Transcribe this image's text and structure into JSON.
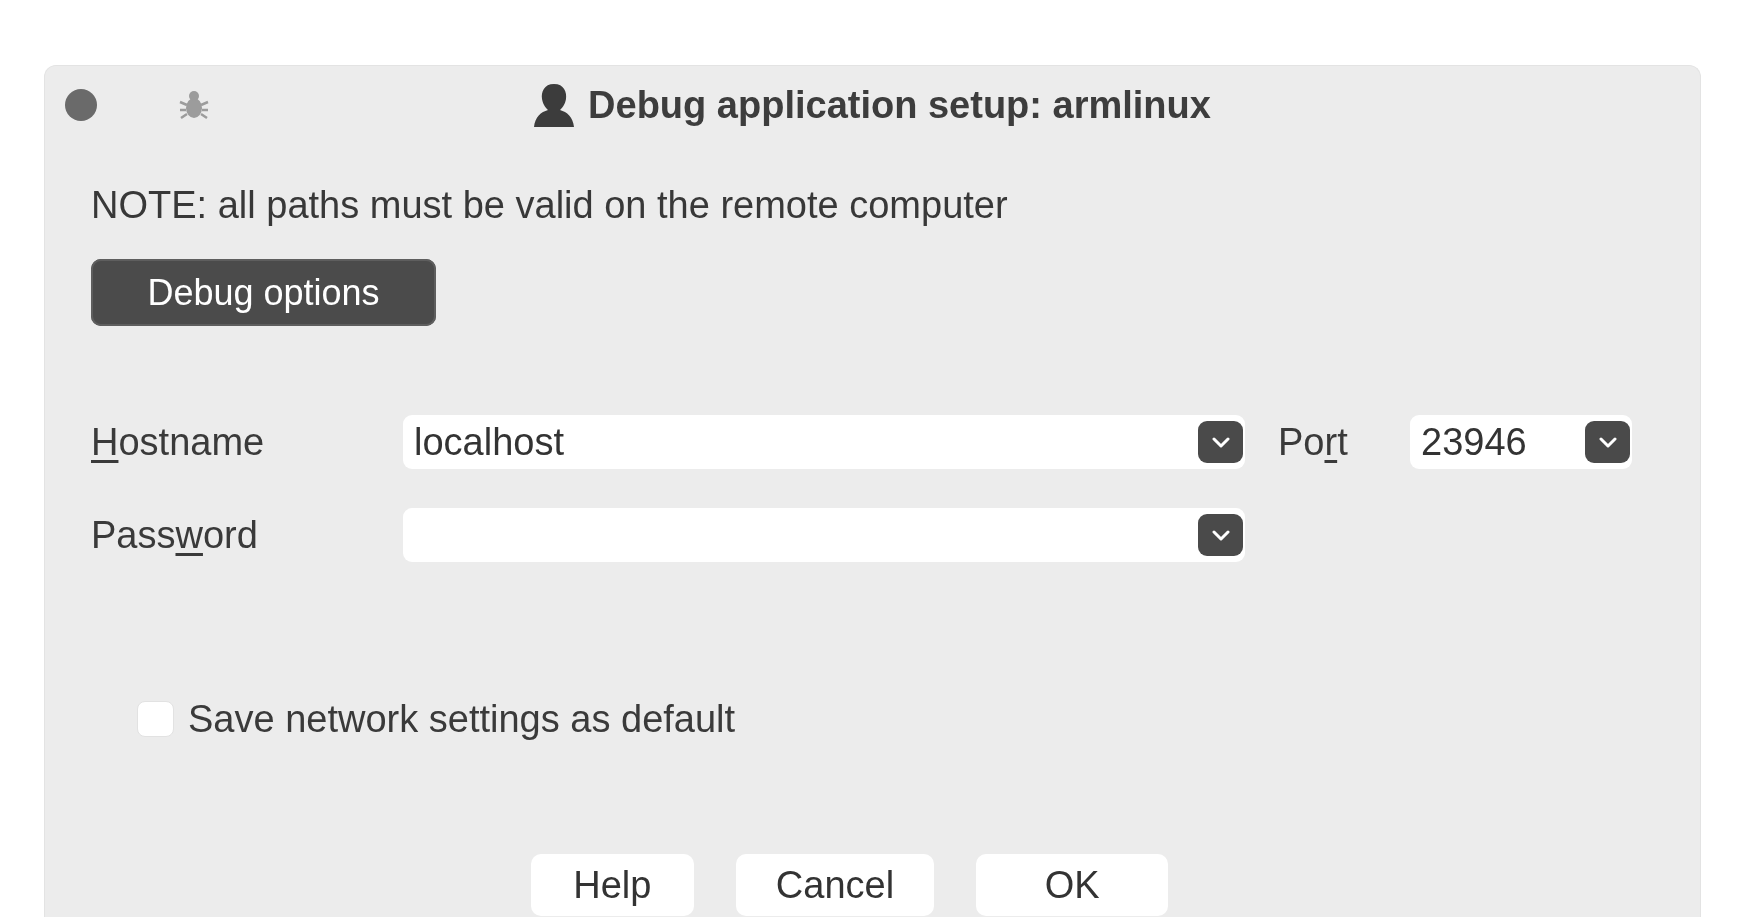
{
  "window": {
    "title": "Debug application setup: armlinux"
  },
  "note": "NOTE: all paths must be valid on the remote computer",
  "options_button": {
    "label": "Debug options"
  },
  "hostname": {
    "label_parts": [
      {
        "text": "H",
        "underlined": true
      },
      {
        "text": "ostname",
        "underlined": false
      }
    ],
    "value": "localhost"
  },
  "port": {
    "label_parts": [
      {
        "text": "Po",
        "underlined": false
      },
      {
        "text": "r",
        "underlined": true
      },
      {
        "text": "t",
        "underlined": false
      }
    ],
    "value": "23946"
  },
  "password": {
    "label_parts": [
      {
        "text": "Pass",
        "underlined": false
      },
      {
        "text": "w",
        "underlined": true
      },
      {
        "text": "ord",
        "underlined": false
      }
    ]
  },
  "save_default": {
    "label": "Save network settings as default",
    "checked": false
  },
  "buttons": [
    "Help",
    "Cancel",
    "OK"
  ]
}
